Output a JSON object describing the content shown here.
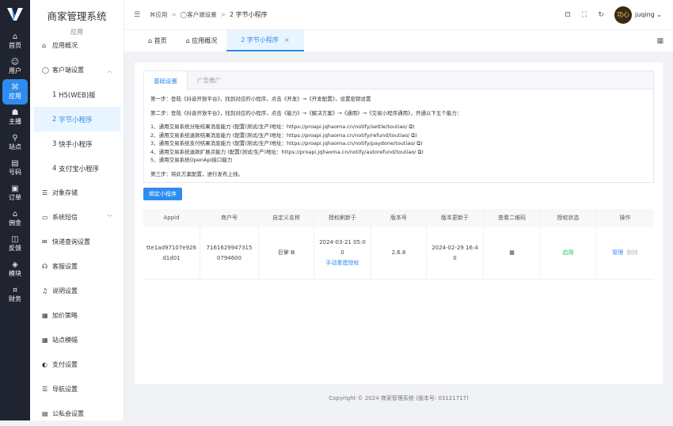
{
  "rail": {
    "items": [
      {
        "label": "首页",
        "icon": "home-icon",
        "glyph": "⌂"
      },
      {
        "label": "用户",
        "icon": "user-icon",
        "glyph": "☺"
      },
      {
        "label": "应用",
        "icon": "apps-icon",
        "glyph": "⌘"
      },
      {
        "label": "主播",
        "icon": "broadcast-icon",
        "glyph": "☗"
      },
      {
        "label": "站点",
        "icon": "site-icon",
        "glyph": "⚲"
      },
      {
        "label": "号码",
        "icon": "number-icon",
        "glyph": "▤"
      },
      {
        "label": "订单",
        "icon": "order-icon",
        "glyph": "▣"
      },
      {
        "label": "佣金",
        "icon": "commission-icon",
        "glyph": "⌂"
      },
      {
        "label": "反馈",
        "icon": "feedback-icon",
        "glyph": "◫"
      },
      {
        "label": "模块",
        "icon": "module-icon",
        "glyph": "◈"
      },
      {
        "label": "财务",
        "icon": "finance-icon",
        "glyph": "¤"
      }
    ]
  },
  "sidebar": {
    "title": "商家管理系统",
    "subtitle": "应用",
    "items": [
      {
        "label": "应用概况",
        "glyph": "⌂"
      },
      {
        "label": "客户端设置",
        "glyph": "◯",
        "chevron": "︿"
      },
      {
        "label": "H5(WEB)版",
        "num": "1"
      },
      {
        "label": "字节小程序",
        "num": "2"
      },
      {
        "label": "快手小程序",
        "num": "3"
      },
      {
        "label": "支付宝小程序",
        "num": "4"
      },
      {
        "label": "对象存储",
        "glyph": "☰"
      },
      {
        "label": "系统短信",
        "glyph": "▭",
        "chevron": "﹀"
      },
      {
        "label": "快递查询设置",
        "glyph": "✉"
      },
      {
        "label": "客服设置",
        "glyph": "☊"
      },
      {
        "label": "说明设置",
        "glyph": "♫"
      },
      {
        "label": "加价策略",
        "glyph": "▦"
      },
      {
        "label": "站点模幅",
        "glyph": "▦"
      },
      {
        "label": "支付设置",
        "glyph": "◐"
      },
      {
        "label": "导航设置",
        "glyph": "☰"
      },
      {
        "label": "公私会设置",
        "glyph": "▤"
      }
    ]
  },
  "header": {
    "breadcrumb": [
      "应用",
      "客户端设置",
      "2 字节小程序"
    ],
    "username": "juqing",
    "avatar_text": "功心"
  },
  "tabs": [
    {
      "label": "首页",
      "glyph": "⌂"
    },
    {
      "label": "应用概况",
      "glyph": "⌂"
    },
    {
      "label": "2 字节小程序",
      "close": "×"
    }
  ],
  "config": {
    "tabs": [
      "基础设置",
      "广告推广"
    ],
    "steps": [
      "第一步：登陆《抖音开放平台》，找到对应的小程序，点击《开发》→《开发配置》，设置密钥设置",
      "第二步：登陆《抖音开放平台》，找到对应的小程序，点击《能力》→《解决方案》→《通用》→《交易小程序通用》，开通以下五个能力："
    ],
    "abilities": [
      "1、通用交易系统分账结果消息能力 (配置(测试/生产)地址：https://proapi.jqhaoma.cn/notify/settle/toutiao/ ⧉)",
      "2、通用交易系统退款结果消息能力 (配置(测试/生产)地址：https://proapi.jqhaoma.cn/notify/refund/toutiao/ ⧉)",
      "3、通用交易系统支付结果消息能力 (配置(测试/生产)地址：https://proapi.jqhaoma.cn/notify/paydone/toutiao/ ⧉)",
      "4、通用交易系统退款扩展点能力 (配置(测试/生产)地址：https://proapi.jqhaoma.cn/notify/autorefund/toutiao/ ⧉)",
      "5、通用交易系统OpenApi接口能力"
    ],
    "step3": "第三步：将此方案配置，进行发布上线。"
  },
  "bind_button": "绑定小程序",
  "table": {
    "headers": [
      "Appid",
      "商户号",
      "自定义名称",
      "授权刷新于",
      "版本号",
      "版本更新于",
      "查看二维码",
      "授权状态",
      "操作"
    ],
    "rows": [
      {
        "appid_1": "tte1ad97107e926",
        "appid_2": "d1d01",
        "merchant_1": "7161629947315",
        "merchant_2": "0794600",
        "name": "巨掌 ⧉",
        "auth_1": "2024-03-21 05:0",
        "auth_2": "0",
        "reauth": "手动重建授权",
        "version": "2.6.8",
        "ver_1": "2024-02-29 16:4",
        "ver_2": "0",
        "qr": "▦",
        "status": "启用",
        "manage": "管理",
        "delete": "删除"
      }
    ]
  },
  "footer": "Copyright © 2024 商家管理系统 (版本号: 03121717)"
}
